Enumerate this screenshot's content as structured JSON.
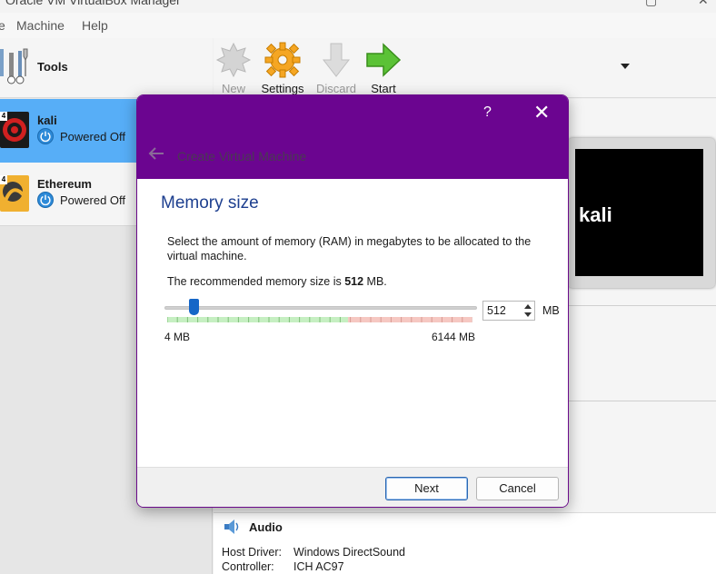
{
  "window": {
    "title": "Oracle VM VirtualBox Manager"
  },
  "menu": [
    "e",
    "Machine",
    "Help"
  ],
  "sidebar": {
    "tools_label": "Tools",
    "vms": [
      {
        "name": "kali",
        "state": "Powered Off",
        "badge": "4"
      },
      {
        "name": "Ethereum",
        "state": "Powered Off",
        "badge": "4"
      }
    ]
  },
  "toolbar": {
    "buttons": [
      {
        "label": "New",
        "enabled": false,
        "icon": "new-icon"
      },
      {
        "label": "Settings",
        "enabled": true,
        "icon": "gear-icon"
      },
      {
        "label": "Discard",
        "enabled": false,
        "icon": "discard-arrow-icon"
      },
      {
        "label": "Start",
        "enabled": true,
        "icon": "start-arrow-icon"
      }
    ]
  },
  "preview": {
    "text": "kali"
  },
  "audio": {
    "title": "Audio",
    "rows": [
      {
        "key": "Host Driver:",
        "value": "Windows DirectSound"
      },
      {
        "key": "Controller:",
        "value": "ICH AC97"
      }
    ]
  },
  "dialog": {
    "help": "?",
    "close": "✕",
    "title": "Create Virtual Machine",
    "heading": "Memory size",
    "description": "Select the amount of memory (RAM) in megabytes to be allocated to the virtual machine.",
    "recommend_prefix": "The recommended memory size is ",
    "recommend_value": "512",
    "recommend_suffix": " MB.",
    "slider": {
      "min_label": "4 MB",
      "max_label": "6144 MB",
      "min": 4,
      "max": 6144,
      "value": 512
    },
    "spin_value": "512",
    "unit": "MB",
    "next_label": "Next",
    "cancel_label": "Cancel"
  },
  "colors": {
    "dialog_header": "#6b0590",
    "heading": "#1d3f8f",
    "selected_row": "#57aef7",
    "slider_handle": "#1566c7"
  }
}
